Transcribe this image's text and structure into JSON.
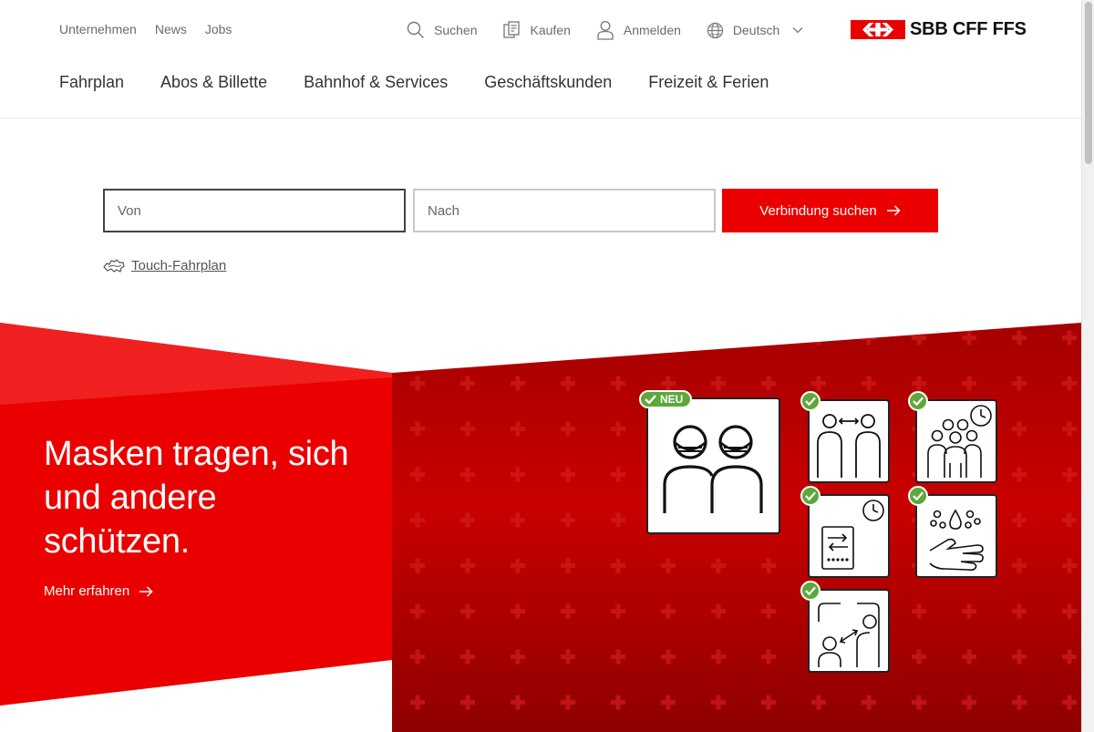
{
  "meta_nav": [
    "Unternehmen",
    "News",
    "Jobs"
  ],
  "tools": {
    "search": "Suchen",
    "buy": "Kaufen",
    "login": "Anmelden",
    "language": "Deutsch"
  },
  "brand": {
    "name": "SBB CFF FFS",
    "color": "#eb0000"
  },
  "main_nav": [
    "Fahrplan",
    "Abos & Billette",
    "Bahnhof & Services",
    "Geschäftskunden",
    "Freizeit & Ferien"
  ],
  "search": {
    "from_placeholder": "Von",
    "to_placeholder": "Nach",
    "button_label": "Verbindung suchen",
    "touch_link": "Touch-Fahrplan"
  },
  "hero": {
    "title": "Masken tragen, sich und andere schützen.",
    "link": "Mehr erfahren",
    "badge_new": "NEU"
  },
  "icons": {
    "search": "search-icon",
    "buy": "ticket-icon",
    "login": "user-icon",
    "language": "globe-icon",
    "dropdown": "chevron-down-icon",
    "arrow": "arrow-right-icon",
    "touch": "swiss-map-icon",
    "check": "check-icon"
  },
  "colors": {
    "accent": "#eb0000",
    "check": "#5ea83b",
    "hero_dark": "#b50000"
  }
}
